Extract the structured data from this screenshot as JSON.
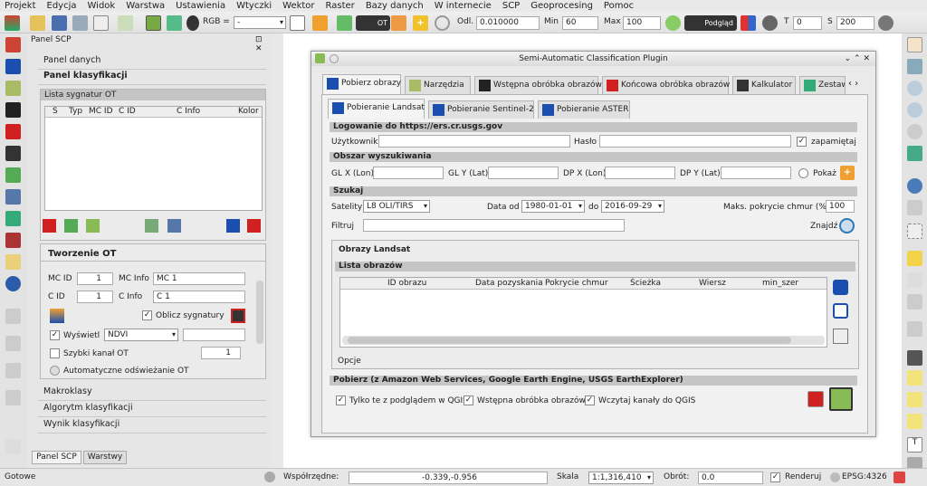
{
  "menu": [
    "Projekt",
    "Edycja",
    "Widok",
    "Warstwa",
    "Ustawienia",
    "Wtyczki",
    "Wektor",
    "Raster",
    "Bazy danych",
    "W internecie",
    "SCP",
    "Geoprocesing",
    "Pomoc"
  ],
  "toolbar": {
    "rgb_label": "RGB =",
    "band_combo": "-",
    "ot_label": "OT",
    "odl_label": "Odl.",
    "odl_value": "0.010000",
    "min_label": "Min",
    "min_value": "60",
    "max_label": "Max",
    "max_value": "100",
    "podglad_label": "Podgląd",
    "t_label": "T",
    "t_value": "0",
    "s_label": "S",
    "s_value": "200"
  },
  "panel": {
    "title": "Panel SCP",
    "panel_danych": "Panel danych",
    "panel_klasyfikacji": "Panel klasyfikacji",
    "lista_sygnatur": "Lista sygnatur OT",
    "columns": [
      "S",
      "Typ",
      "MC ID",
      "C ID",
      "C Info",
      "Kolor"
    ],
    "tworzenie_ot": "Tworzenie OT",
    "mc_id_label": "MC ID",
    "mc_id_value": "1",
    "mc_info_label": "MC Info",
    "mc_info_value": "MC 1",
    "c_id_label": "C ID",
    "c_id_value": "1",
    "c_info_label": "C Info",
    "c_info_value": "C 1",
    "oblicz": "Oblicz sygnatury",
    "wyswietl": "Wyświetl",
    "ndvi": "NDVI",
    "szybki": "Szybki kanał OT",
    "szybki_value": "1",
    "auto": "Automatyczne odświeżanie OT",
    "makroklasy": "Makroklasy",
    "algorytm": "Algorytm klasyfikacji",
    "wynik": "Wynik klasyfikacji",
    "tab_scp": "Panel SCP",
    "tab_warstwy": "Warstwy"
  },
  "dialog": {
    "title": "Semi-Automatic Classification Plugin",
    "tabs": [
      "Pobierz obrazy",
      "Narzędzia",
      "Wstępna obróbka obrazów",
      "Końcowa obróbka obrazów",
      "Kalkulator",
      "Zestaw"
    ],
    "subtabs": [
      "Pobieranie Landsat",
      "Pobieranie Sentinel-2",
      "Pobieranie ASTER"
    ],
    "login_group": "Logowanie do https://ers.cr.usgs.gov",
    "user_label": "Użytkownik",
    "pass_label": "Hasło",
    "remember": "zapamiętaj",
    "area_group": "Obszar wyszukiwania",
    "glx": "GL X (Lon)",
    "gly": "GL Y (Lat)",
    "dpx": "DP X (Lon)",
    "dpy": "DP Y (Lat)",
    "pokaz": "Pokaż",
    "search_group": "Szukaj",
    "satelity": "Satelity",
    "satellite_value": "L8 OLI/TIRS",
    "data_od": "Data od",
    "date_from": "1980-01-01",
    "do": "do",
    "date_to": "2016-09-29",
    "max_cloud_label": "Maks. pokrycie chmur (%)",
    "max_cloud": "100",
    "filtruj": "Filtruj",
    "znajdz": "Znajdź",
    "obrazy_landsat": "Obrazy Landsat",
    "lista_obrazow": "Lista obrazów",
    "list_columns": [
      "ID obrazu",
      "Data pozyskania",
      "Pokrycie chmur",
      "Ścieżka",
      "Wiersz",
      "min_szer"
    ],
    "opcje": "Opcje",
    "download_group": "Pobierz (z Amazon Web Services, Google Earth Engine, USGS EarthExplorer)",
    "only_preview": "Tylko te z podglądem w QGIS",
    "preprocess": "Wstępna obróbka obrazów",
    "load_bands": "Wczytaj kanały do QGIS"
  },
  "status": {
    "ready": "Gotowe",
    "coord_label": "Współrzędne:",
    "coord_value": "-0.339,-0.956",
    "scale_label": "Skala",
    "scale_value": "1:1,316,410",
    "rotation_label": "Obrót:",
    "rotation_value": "0.0",
    "render": "Renderuj",
    "epsg": "EPSG:4326"
  },
  "colors": {
    "accent_orange": "#f0a030",
    "red": "#d02020",
    "blue": "#1a4fb0",
    "green": "#2a8a2a"
  }
}
